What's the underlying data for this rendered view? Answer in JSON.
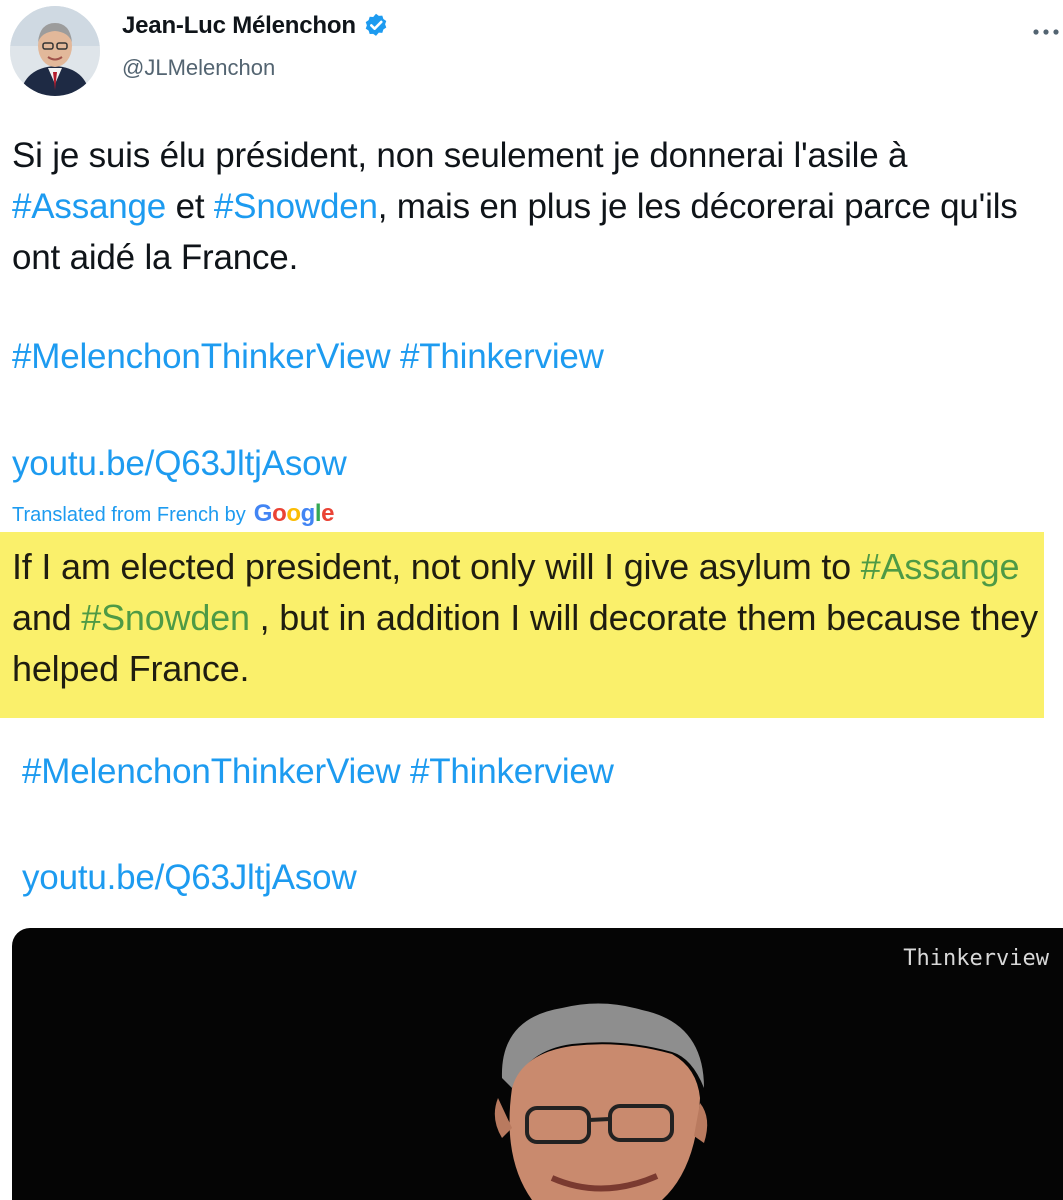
{
  "author": {
    "name": "Jean-Luc Mélenchon",
    "handle": "@JLMelenchon",
    "verified_icon": "verified-badge-icon",
    "verified_color": "#1d9bf0"
  },
  "tweet": {
    "original": {
      "part1": "Si je suis élu président, non seulement je donnerai l'asile à ",
      "tag_assange": "#Assange",
      "part2": " et ",
      "tag_snowden": "#Snowden",
      "part3": ", mais en plus je les décorerai parce qu'ils ont aidé la France."
    },
    "hashtags": "#MelenchonThinkerView #Thinkerview",
    "link": "youtu.be/Q63JltjAsow",
    "translated_label": "Translated from French by",
    "translator": "Google",
    "translation": {
      "part1": "If I am elected president, not only will I give asylum to ",
      "tag_assange": "#Assange",
      "part2": " and ",
      "tag_snowden": "#Snowden",
      "part3": " , but in addition I will decorate them because they helped France."
    },
    "hashtags_translated": "#MelenchonThinkerView #Thinkerview",
    "link_translated": "youtu.be/Q63JltjAsow"
  },
  "media": {
    "watermark": "Thinkerview",
    "background_color": "#050505"
  },
  "colors": {
    "link": "#1d9bf0",
    "highlight": "#faf06b",
    "highlight_link": "#4e9a45",
    "text": "#0f1419",
    "secondary": "#536471"
  }
}
